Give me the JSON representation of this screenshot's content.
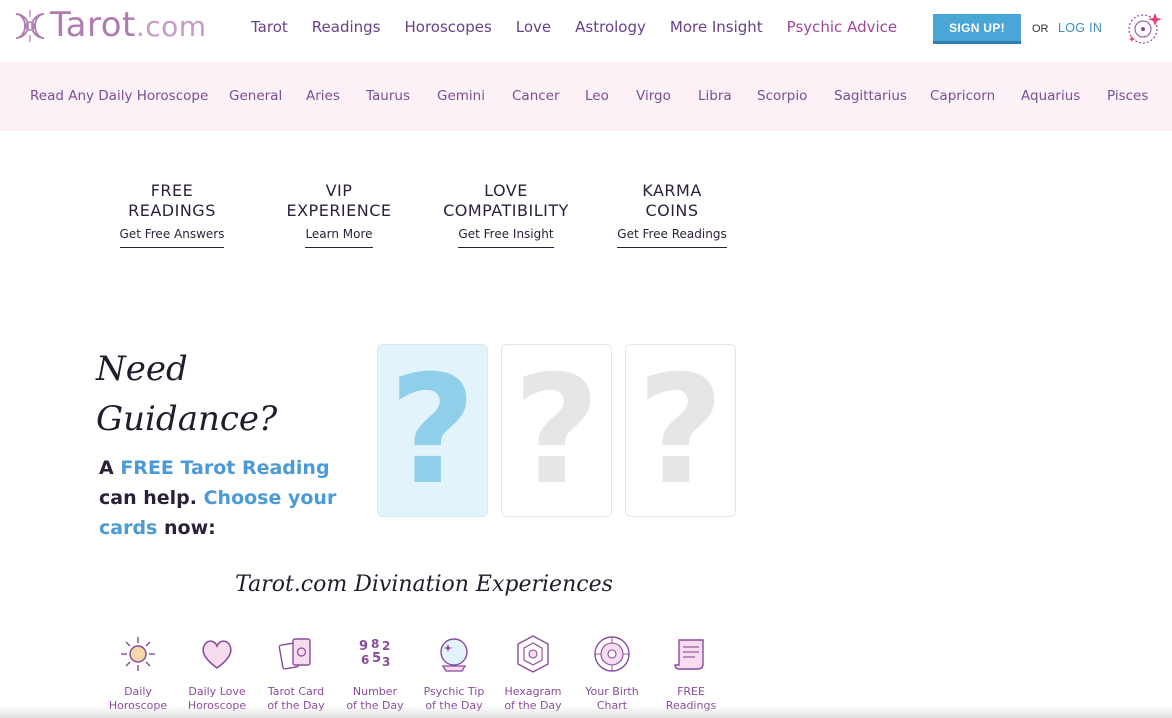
{
  "header": {
    "logo_text": "Tarot",
    "logo_suffix": ".com",
    "nav": [
      "Tarot",
      "Readings",
      "Horoscopes",
      "Love",
      "Astrology",
      "More Insight",
      "Psychic Advice"
    ],
    "signup_label": "SIGN UP!",
    "or_label": "OR",
    "login_label": "LOG IN"
  },
  "horoscope_bar": {
    "items": [
      "Read Any Daily Horoscope",
      "General",
      "Aries",
      "Taurus",
      "Gemini",
      "Cancer",
      "Leo",
      "Virgo",
      "Libra",
      "Scorpio",
      "Sagittarius",
      "Capricorn",
      "Aquarius",
      "Pisces"
    ]
  },
  "features": [
    {
      "title1": "FREE",
      "title2": "READINGS",
      "link": "Get Free Answers"
    },
    {
      "title1": "VIP",
      "title2": "EXPERIENCE",
      "link": "Learn More"
    },
    {
      "title1": "LOVE",
      "title2": "COMPATIBILITY",
      "link": "Get Free Insight"
    },
    {
      "title1": "KARMA",
      "title2": "COINS",
      "link": "Get Free Readings"
    }
  ],
  "guidance": {
    "line1": "Need",
    "line2": "Guidance?",
    "t1": "A ",
    "t2": "FREE Tarot Reading",
    "t3": " can help. ",
    "t4": "Choose your cards",
    "t5": " now:"
  },
  "cards": [
    "?",
    "?",
    "?"
  ],
  "divination": {
    "title": "Tarot.com Divination Experiences",
    "items": [
      {
        "l1": "Daily",
        "l2": "Horoscope",
        "icon": "sun-icon"
      },
      {
        "l1": "Daily Love",
        "l2": "Horoscope",
        "icon": "heart-icon"
      },
      {
        "l1": "Tarot Card",
        "l2": "of the Day",
        "icon": "tarot-cards-icon"
      },
      {
        "l1": "Number",
        "l2": "of the Day",
        "icon": "numbers-icon"
      },
      {
        "l1": "Psychic Tip",
        "l2": "of the Day",
        "icon": "crystal-ball-icon"
      },
      {
        "l1": "Hexagram",
        "l2": "of the Day",
        "icon": "hexagram-icon"
      },
      {
        "l1": "Your Birth",
        "l2": "Chart",
        "icon": "birth-chart-icon"
      },
      {
        "l1": "FREE",
        "l2": "Readings",
        "icon": "scroll-icon"
      }
    ]
  },
  "colors": {
    "brand_purple": "#6a3f8a",
    "accent_blue": "#4a9ad6",
    "signup_blue": "#4aa6d6",
    "horo_bar_bg": "#fbf1f7"
  }
}
